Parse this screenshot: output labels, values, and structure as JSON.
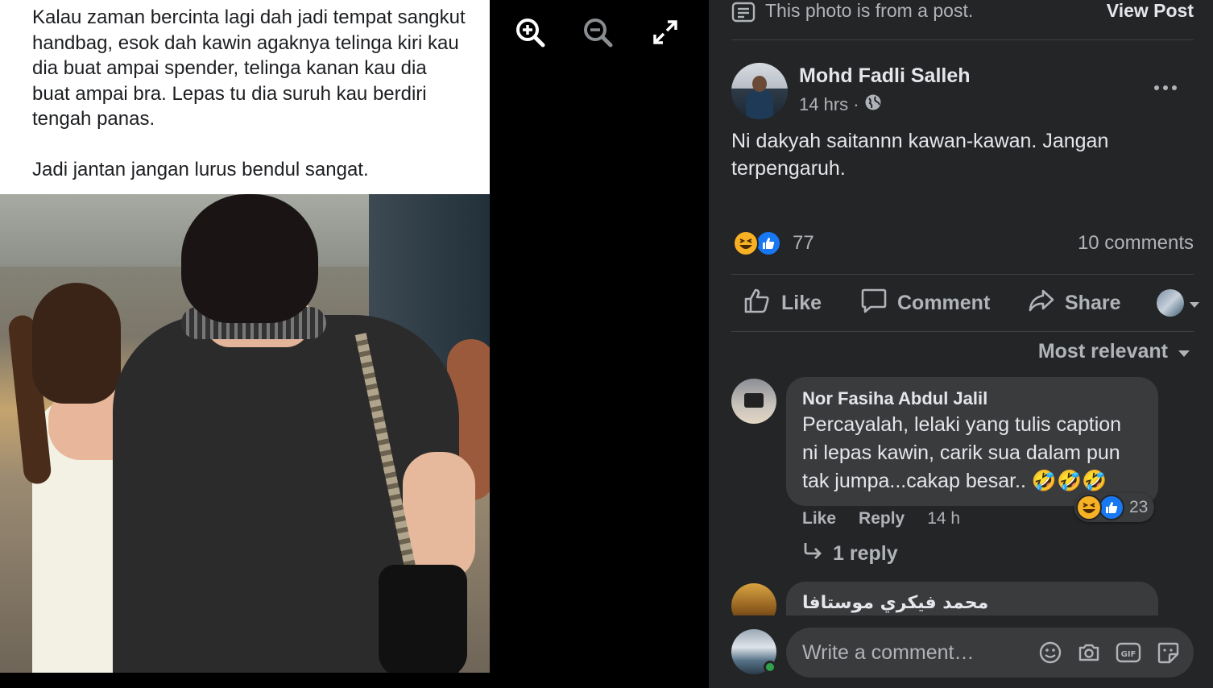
{
  "photo": {
    "caption_lines": [
      "Kalau zaman bercinta lagi dah jadi tempat sangkut handbag, esok dah kawin agaknya telinga kiri kau dia buat ampai spender, telinga kanan kau dia buat ampai bra. Lepas tu dia suruh kau berdiri tengah panas.",
      "Jadi jantan jangan lurus bendul sangat."
    ]
  },
  "viewer_tools": [
    "zoom-in-icon",
    "zoom-out-icon",
    "fullscreen-icon"
  ],
  "source_bar": {
    "text": "This photo is from a post.",
    "view_post": "View Post"
  },
  "post": {
    "author": "Mohd Fadli Salleh",
    "time": "14 hrs ·",
    "audience_icon": "globe-icon",
    "text": "Ni dakyah saitannn kawan-kawan. Jangan terpengaruh.",
    "reaction_count": "77",
    "comment_count": "10 comments"
  },
  "actions": {
    "like": "Like",
    "comment": "Comment",
    "share": "Share"
  },
  "sort": {
    "label": "Most relevant"
  },
  "comments": [
    {
      "author": "Nor Fasiha Abdul Jalil",
      "text": "Percayalah, lelaki yang tulis caption ni lepas kawin, carik sua dalam pun tak jumpa...cakap besar.. 🤣🤣🤣",
      "reaction_count": "23",
      "like": "Like",
      "reply": "Reply",
      "time": "14 h",
      "replies": "1 reply"
    },
    {
      "author": "محمد فيكري موستافا"
    }
  ],
  "composer": {
    "placeholder": "Write a comment…",
    "tools": [
      "emoji-icon",
      "camera-icon",
      "gif-icon",
      "sticker-icon"
    ]
  },
  "colors": {
    "panel_bg": "#242526",
    "bubble_bg": "#3a3b3c",
    "text_primary": "#e4e6eb",
    "text_secondary": "#b0b3b8",
    "like_blue": "#1877f2",
    "haha_yellow": "#f7b125",
    "online_green": "#31a24c"
  }
}
